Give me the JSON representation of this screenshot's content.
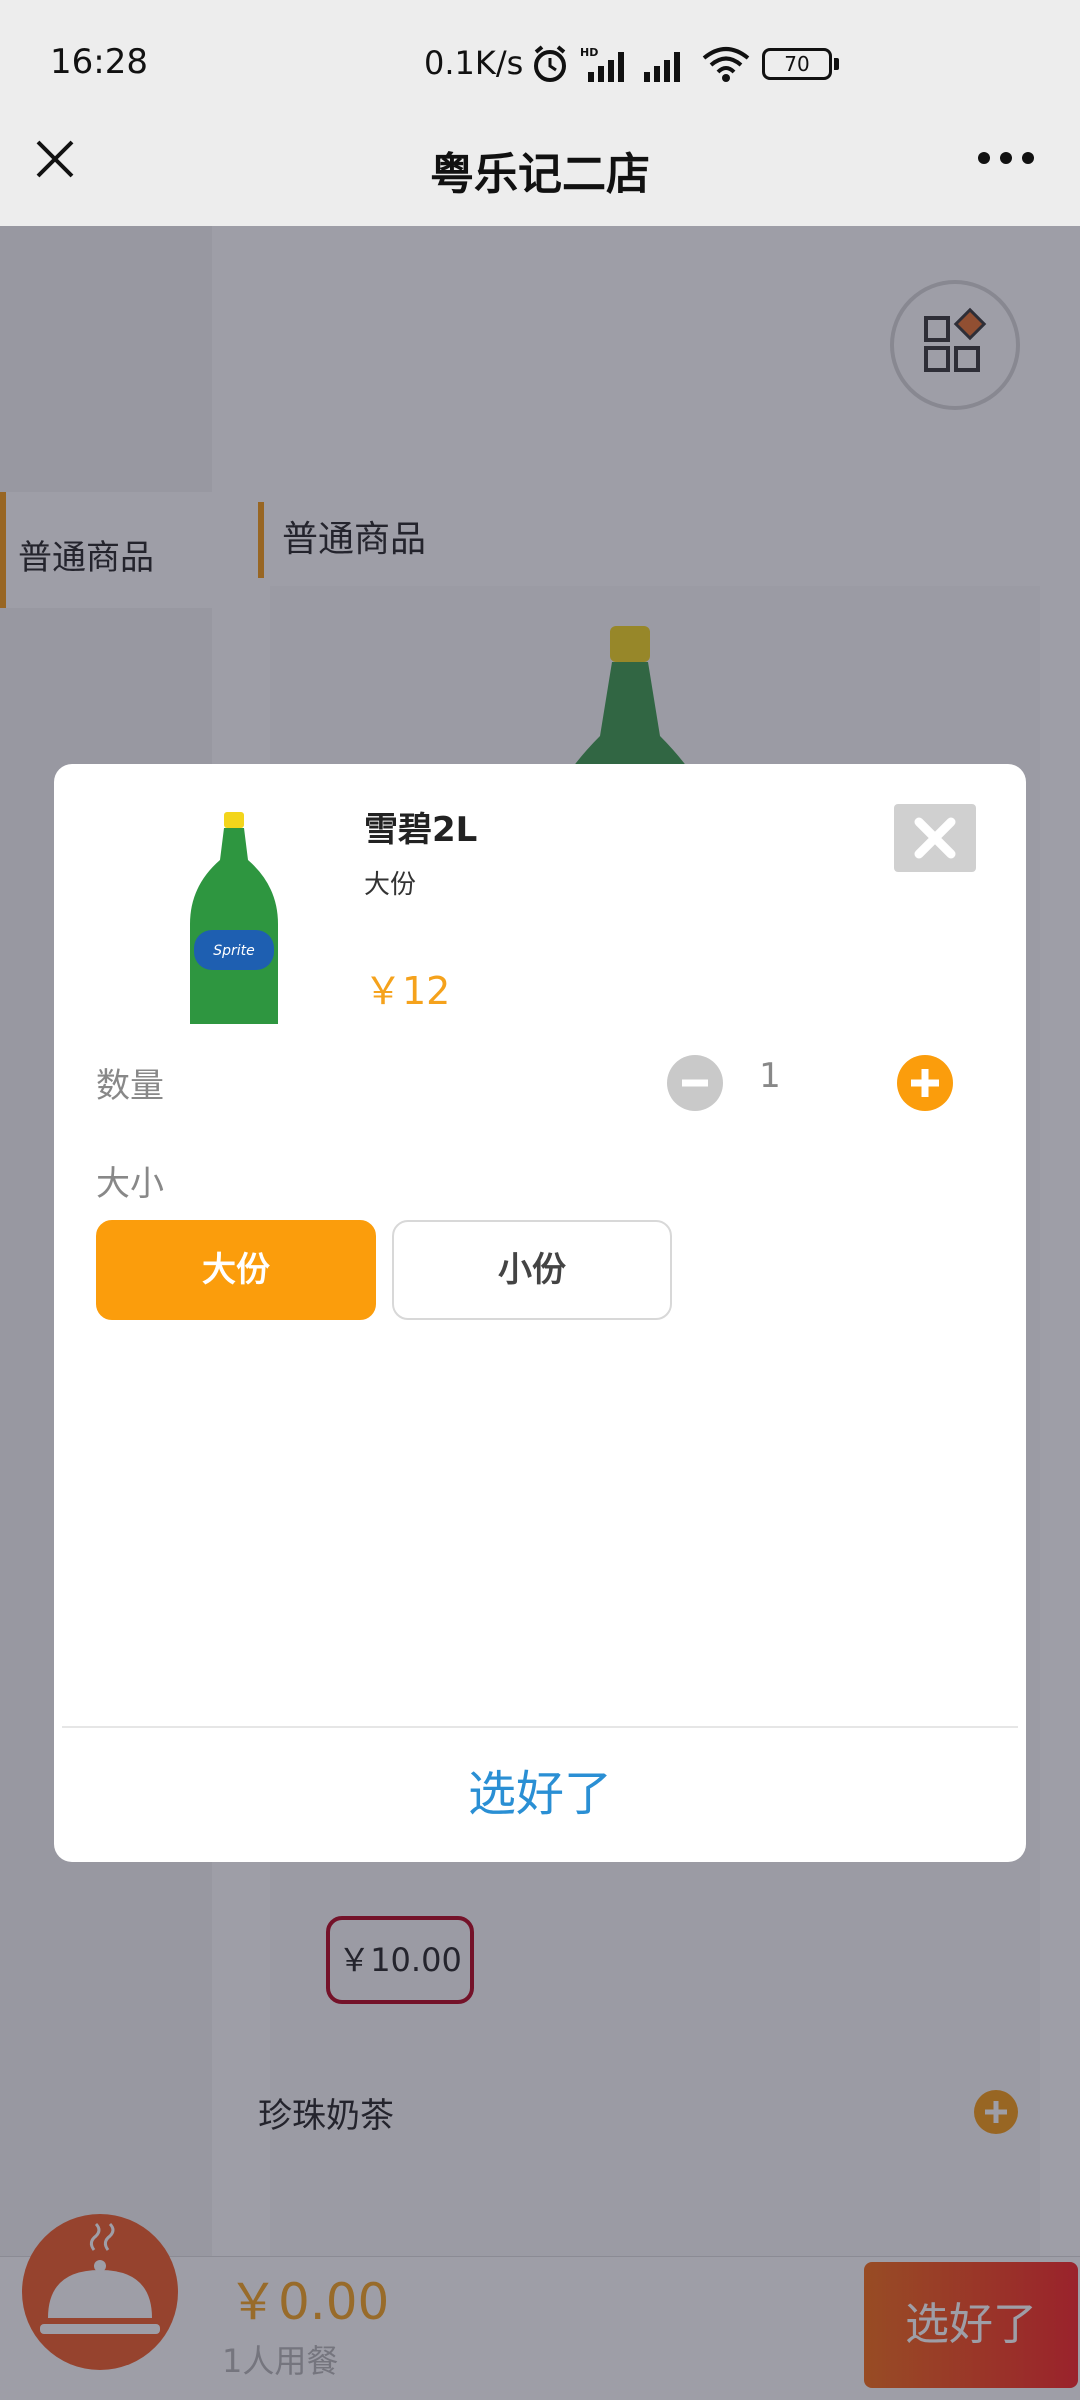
{
  "status_bar": {
    "time": "16:28",
    "network_speed": "0.1K/s",
    "battery": "70"
  },
  "nav": {
    "title": "粤乐记二店"
  },
  "sidebar": {
    "items": [
      {
        "label": "普通商品"
      }
    ]
  },
  "section": {
    "title": "普通商品"
  },
  "products": [
    {
      "price": "￥10.00"
    },
    {
      "name": "珍珠奶茶"
    }
  ],
  "cart": {
    "total": "￥0.00",
    "diners": "1人用餐",
    "checkout_label": "选好了"
  },
  "modal": {
    "product_name": "雪碧2L",
    "variant": "大份",
    "price": "￥12",
    "quantity_label": "数量",
    "quantity": "1",
    "size_label": "大小",
    "size_options": [
      "大份",
      "小份"
    ],
    "confirm_label": "选好了"
  },
  "colors": {
    "accent": "#f59a10",
    "price": "#f5a21c",
    "confirm": "#2a8fd4",
    "checkout_start": "#f56a12",
    "checkout_end": "#f81f1f",
    "price_tag_border": "#b3001b"
  },
  "icons": [
    "close-icon",
    "more-icon",
    "grid-menu-icon",
    "close-square-icon",
    "minus-circle-icon",
    "plus-circle-icon",
    "cart-cloche-icon",
    "alarm-icon",
    "signal-icon",
    "wifi-icon",
    "battery-icon"
  ]
}
